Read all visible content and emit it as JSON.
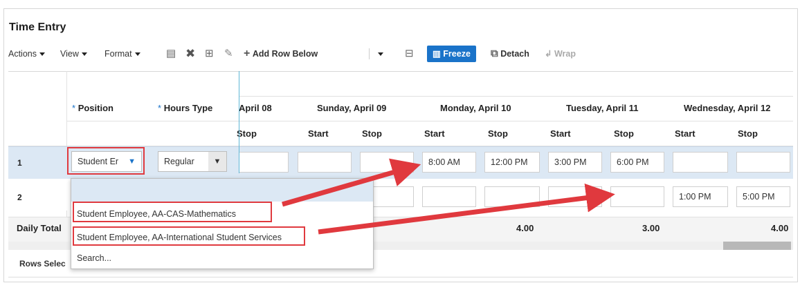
{
  "title": "Time Entry",
  "toolbar": {
    "actions": "Actions",
    "view": "View",
    "format": "Format",
    "add_row_below": "Add Row Below",
    "freeze": "Freeze",
    "detach": "Detach",
    "wrap": "Wrap"
  },
  "columns": {
    "position": "Position",
    "hours_type": "Hours Type",
    "required_marker": "*",
    "days": [
      "April 08",
      "Sunday, April 09",
      "Monday, April 10",
      "Tuesday, April 11",
      "Wednesday, April 12"
    ],
    "start": "Start",
    "stop": "Stop",
    "stop_partial": "Stop"
  },
  "rows": [
    {
      "num": "1",
      "position": "Student Er",
      "hours_type": "Regular",
      "times": [
        "",
        "",
        "",
        "8:00 AM",
        "12:00 PM",
        "3:00 PM",
        "6:00 PM",
        "",
        ""
      ]
    },
    {
      "num": "2",
      "times": [
        "",
        "",
        "",
        "",
        "",
        "",
        "",
        "1:00 PM",
        "5:00 PM"
      ]
    }
  ],
  "daily_total": {
    "label": "Daily Total",
    "values": [
      "4.00",
      "3.00",
      "4.00"
    ]
  },
  "dropdown": {
    "items": [
      "Student Employee, AA-CAS-Mathematics",
      "Student Employee, AA-International Student Services",
      "Search..."
    ]
  },
  "footer": {
    "rows_selected": "Rows Selec"
  },
  "colors": {
    "accent": "#1a73c9",
    "highlight": "#e0393e",
    "row_selected": "#dce8f4"
  }
}
